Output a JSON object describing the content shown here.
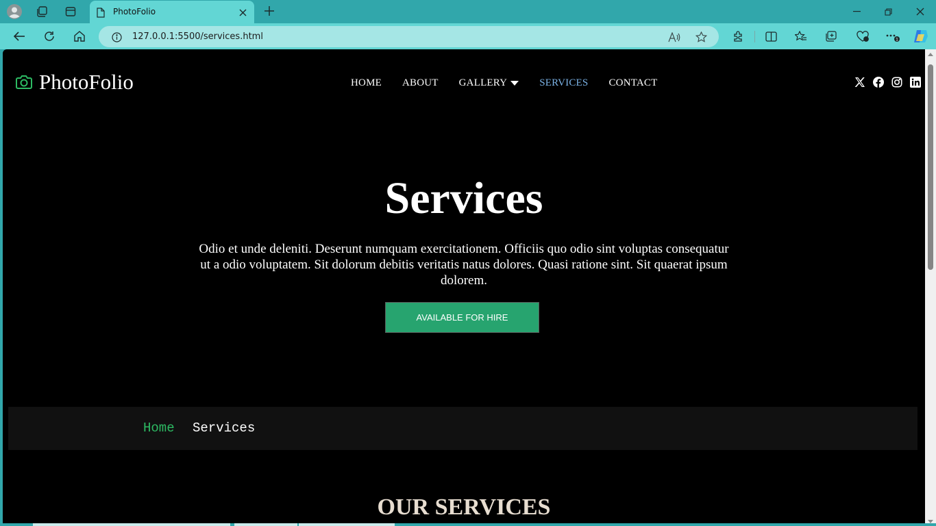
{
  "browser": {
    "tab_title": "PhotoFolio",
    "url": "127.0.0.1:5500/services.html"
  },
  "site": {
    "logo_text": "PhotoFolio",
    "nav": {
      "home": "HOME",
      "about": "ABOUT",
      "gallery": "GALLERY",
      "services": "SERVICES",
      "contact": "CONTACT"
    },
    "social_icons": [
      "x-icon",
      "facebook-icon",
      "instagram-icon",
      "linkedin-icon"
    ]
  },
  "hero": {
    "title": "Services",
    "text": "Odio et unde deleniti. Deserunt numquam exercitationem. Officiis quo odio sint voluptas consequatur ut a odio voluptatem. Sit dolorum debitis veritatis natus dolores. Quasi ratione sint. Sit quaerat ipsum dolorem.",
    "button": "AVAILABLE FOR HIRE"
  },
  "breadcrumb": {
    "home": "Home",
    "current": "Services"
  },
  "section": {
    "title": "OUR SERVICES"
  },
  "colors": {
    "accent_green": "#27a46f",
    "active_nav": "#7cb4e8",
    "breadcrumb_link": "#2dbb63",
    "browser_frame": "#31a7ab"
  }
}
